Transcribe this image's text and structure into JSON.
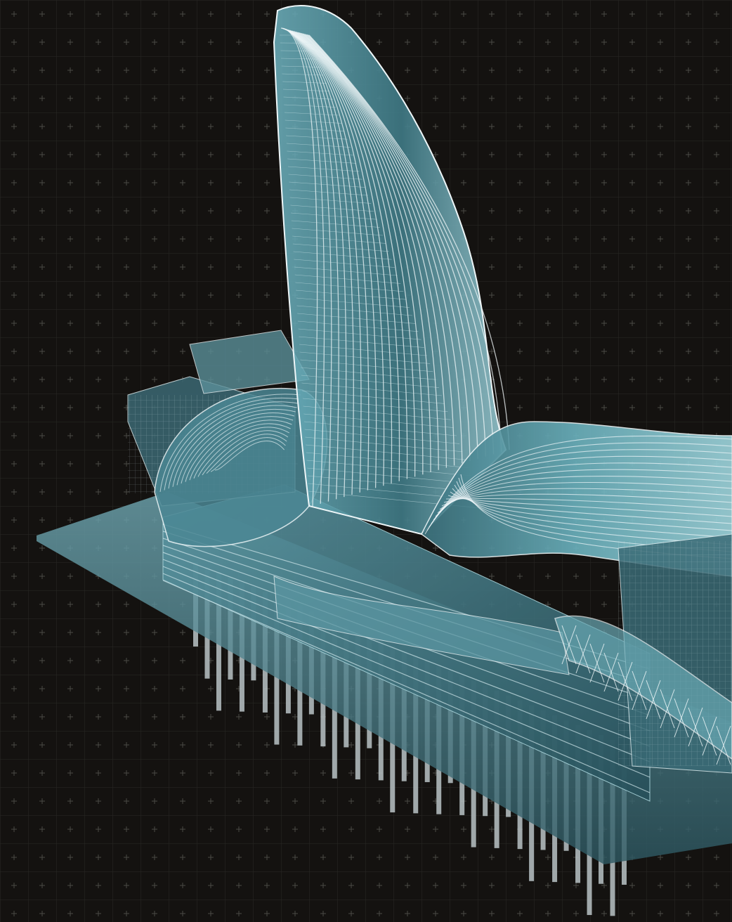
{
  "colors": {
    "background": "#141210",
    "grid_line": "#2a2926",
    "grid_cross": "#5a5955",
    "glass_dark": "#2f5560",
    "glass_mid": "#4e8f9c",
    "glass_light": "#7fc3cf",
    "frame_white": "#e6eef0",
    "piles": "#b9c3c6",
    "base_slab": "#3d6f7b"
  },
  "scene": {
    "pile_count": 38,
    "floor_bands": 9
  }
}
